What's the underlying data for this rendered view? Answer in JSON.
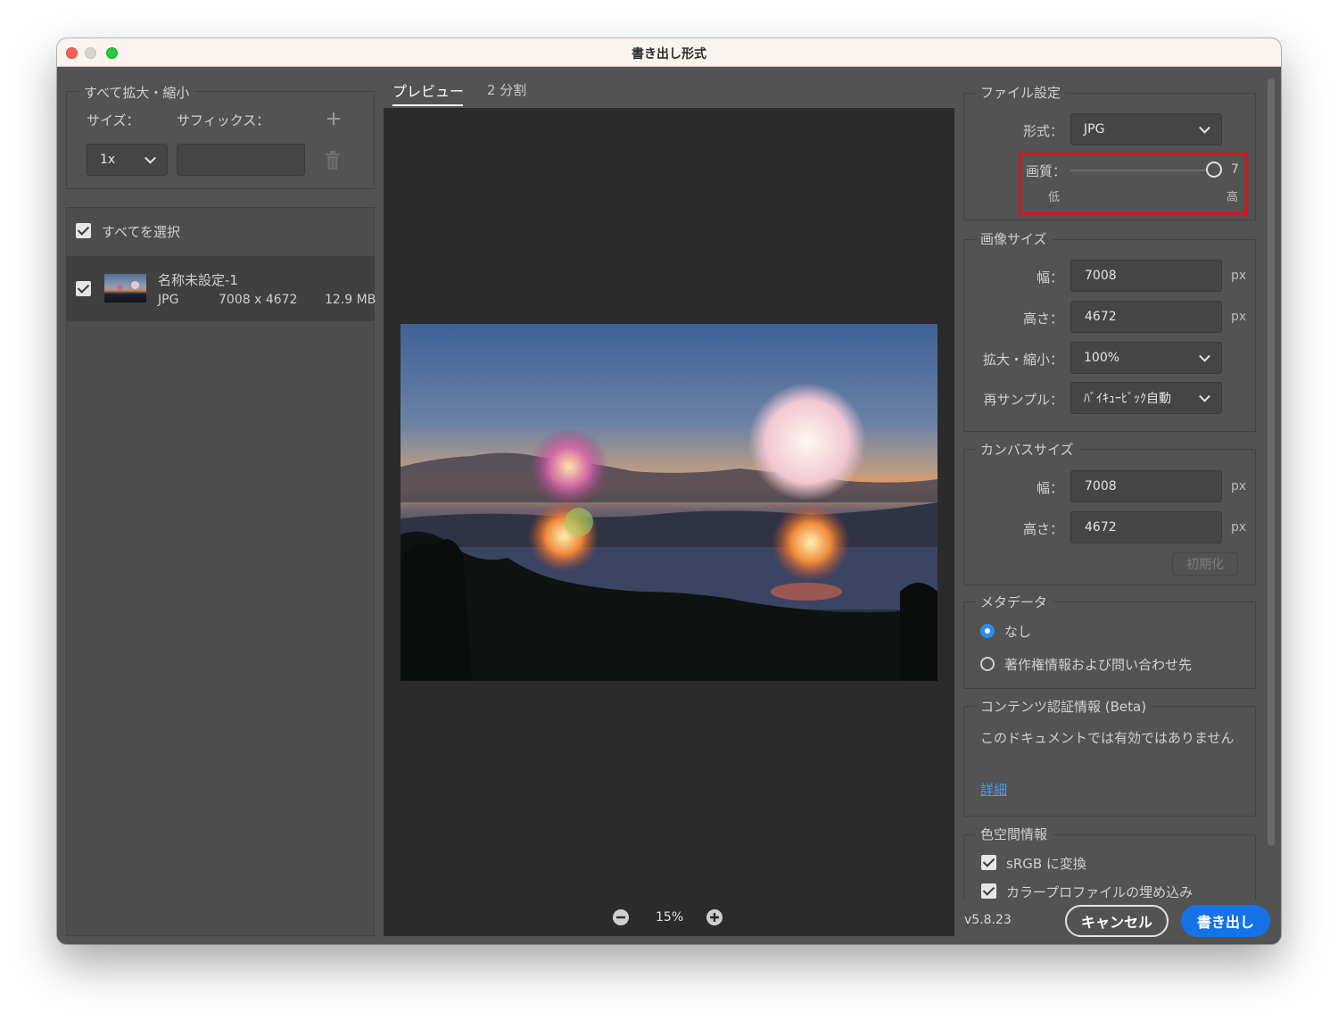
{
  "window": {
    "title": "書き出し形式"
  },
  "left": {
    "scale_all": {
      "title": "すべて拡大・縮小",
      "size_label": "サイズ：",
      "suffix_label": "サフィックス：",
      "size_value": "1x",
      "suffix_value": ""
    },
    "select_all": "すべてを選択",
    "asset": {
      "name": "名称未設定-1",
      "format": "JPG",
      "dimensions": "7008 x 4672",
      "filesize": "12.9 MB"
    }
  },
  "preview": {
    "tab_preview": "プレビュー",
    "tab_split": "2 分割",
    "zoom": "15%"
  },
  "right": {
    "file_settings": {
      "title": "ファイル設定",
      "format_label": "形式：",
      "format_value": "JPG",
      "quality_label": "画質：",
      "quality_value": "7",
      "quality_low": "低",
      "quality_high": "高",
      "quality_level": 1.0
    },
    "image_size": {
      "title": "画像サイズ",
      "width_label": "幅：",
      "width_value": "7008",
      "height_label": "高さ：",
      "height_value": "4672",
      "scale_label": "拡大・縮小：",
      "scale_value": "100%",
      "resample_label": "再サンプル：",
      "resample_value": "ﾊﾞｲｷｭｰﾋﾞｯｸ自動",
      "unit": "px"
    },
    "canvas_size": {
      "title": "カンバスサイズ",
      "width_label": "幅：",
      "width_value": "7008",
      "height_label": "高さ：",
      "height_value": "4672",
      "reset_label": "初期化",
      "unit": "px"
    },
    "metadata": {
      "title": "メタデータ",
      "option_none": "なし",
      "option_copyright": "著作権情報および問い合わせ先"
    },
    "content_credentials": {
      "title": "コンテンツ認証情報 (Beta)",
      "message": "このドキュメントでは有効ではありません",
      "details_link": "詳細"
    },
    "color_space": {
      "title": "色空間情報",
      "convert_srgb": "sRGB に変換",
      "embed_profile": "カラープロファイルの埋め込み"
    }
  },
  "footer": {
    "version": "v5.8.23",
    "cancel": "キャンセル",
    "export": "書き出し"
  },
  "colors": {
    "accent": "#1473e6",
    "highlight": "#d0191b",
    "panel": "#535353",
    "canvas": "#2b2b2b"
  }
}
